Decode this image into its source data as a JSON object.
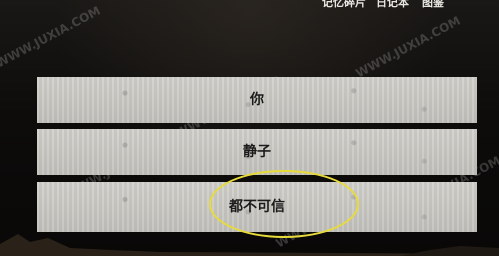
{
  "top_menu": [
    {
      "label": "记忆碎片"
    },
    {
      "label": "日记本"
    },
    {
      "label": "图鉴"
    }
  ],
  "options": [
    {
      "label": "你"
    },
    {
      "label": "静子"
    },
    {
      "label": "都不可信"
    }
  ],
  "watermark": "WWW.JUXIA.COM",
  "colors": {
    "highlight": "#e7db3b",
    "option_bg": "#cfcdc8",
    "background": "#0d0c0b"
  }
}
